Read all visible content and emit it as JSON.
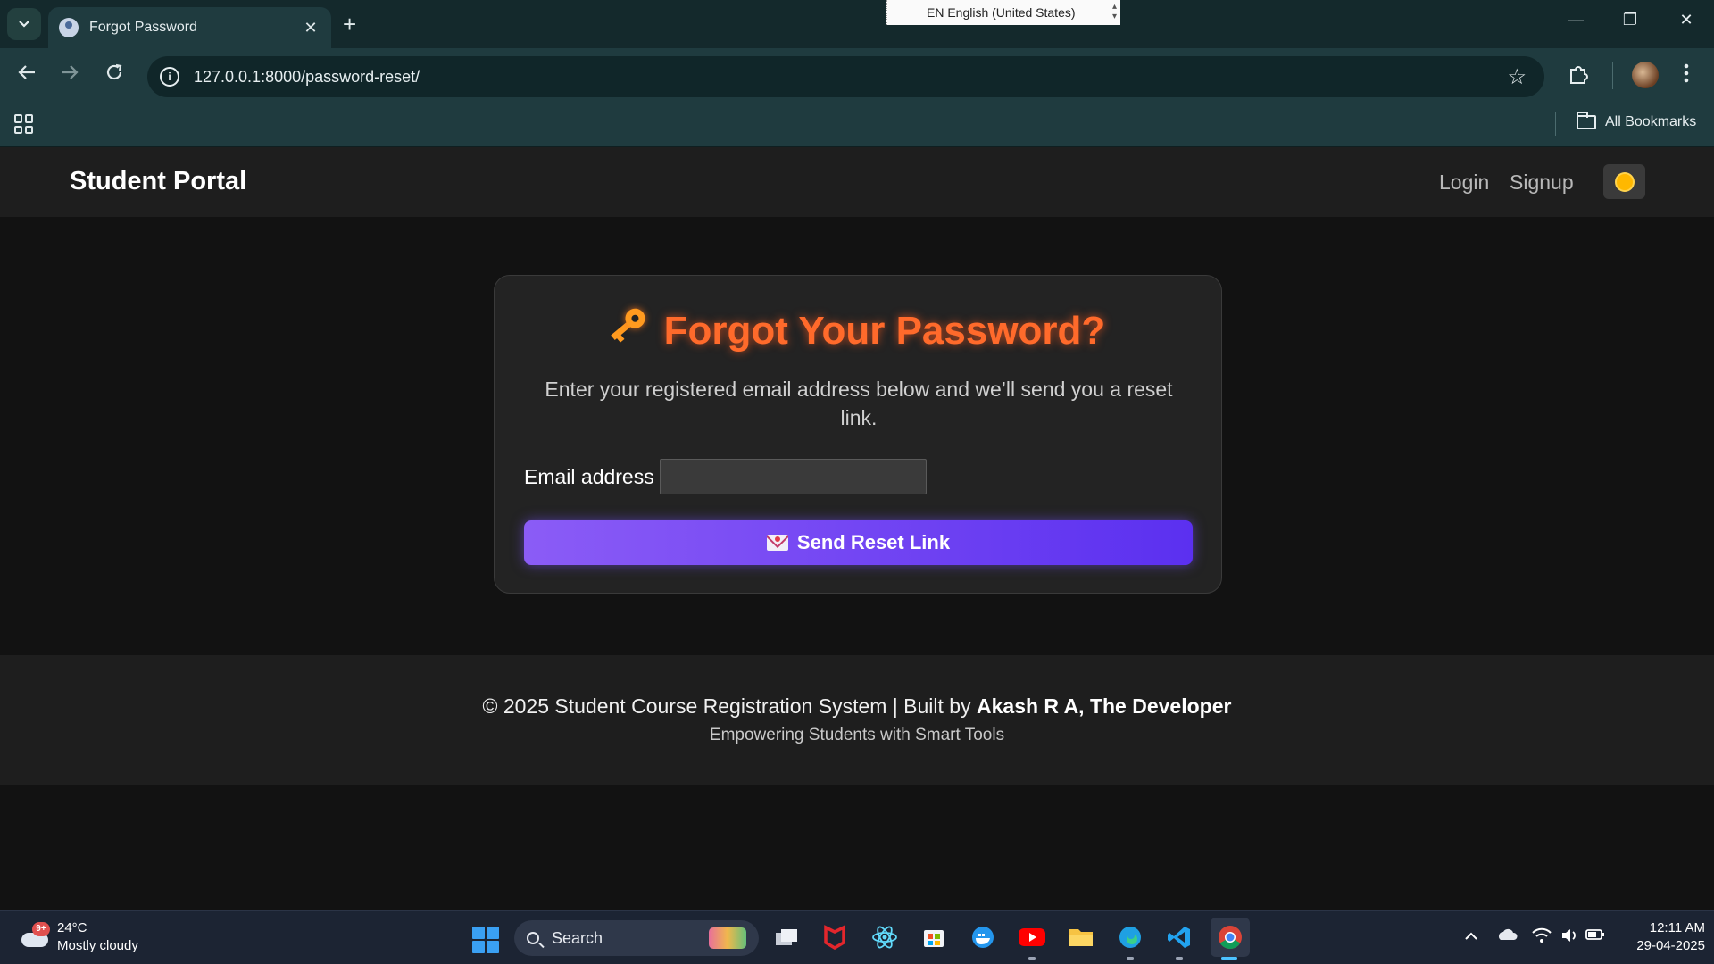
{
  "browser": {
    "tab": {
      "title": "Forgot Password",
      "close": "✕"
    },
    "new_tab": "+",
    "language_bar": "EN English (United States)",
    "address": "127.0.0.1:8000/password-reset/",
    "all_bookmarks": "All Bookmarks",
    "window_controls": {
      "minimize": "—",
      "restore": "❐",
      "close": "✕"
    }
  },
  "site": {
    "brand": "Student Portal",
    "nav": {
      "login": "Login",
      "signup": "Signup"
    },
    "theme_icon": "sun-icon"
  },
  "card": {
    "title": "Forgot Your Password?",
    "description": "Enter your registered email address below and we’ll send you a reset link.",
    "email_label": "Email address",
    "email_value": "",
    "button_label": "Send Reset Link"
  },
  "footer": {
    "line1_prefix": "© 2025 Student Course Registration System | Built by ",
    "line1_author": "Akash R A, The Developer",
    "line2": "Empowering Students with Smart Tools"
  },
  "taskbar": {
    "weather": {
      "badge": "9+",
      "temp": "24°C",
      "desc": "Mostly cloudy"
    },
    "search_label": "Search",
    "apps": [
      "task-view",
      "mcafee",
      "react",
      "microsoft-store",
      "docker",
      "youtube",
      "file-explorer",
      "edge",
      "vscode",
      "chrome"
    ],
    "clock": {
      "time": "12:11 AM",
      "date": "29-04-2025"
    }
  },
  "colors": {
    "accent_orange": "#ff6a2b",
    "button_start": "#8b5cf6",
    "button_end": "#5b30f0",
    "browser_chrome": "#1f3b3f"
  }
}
